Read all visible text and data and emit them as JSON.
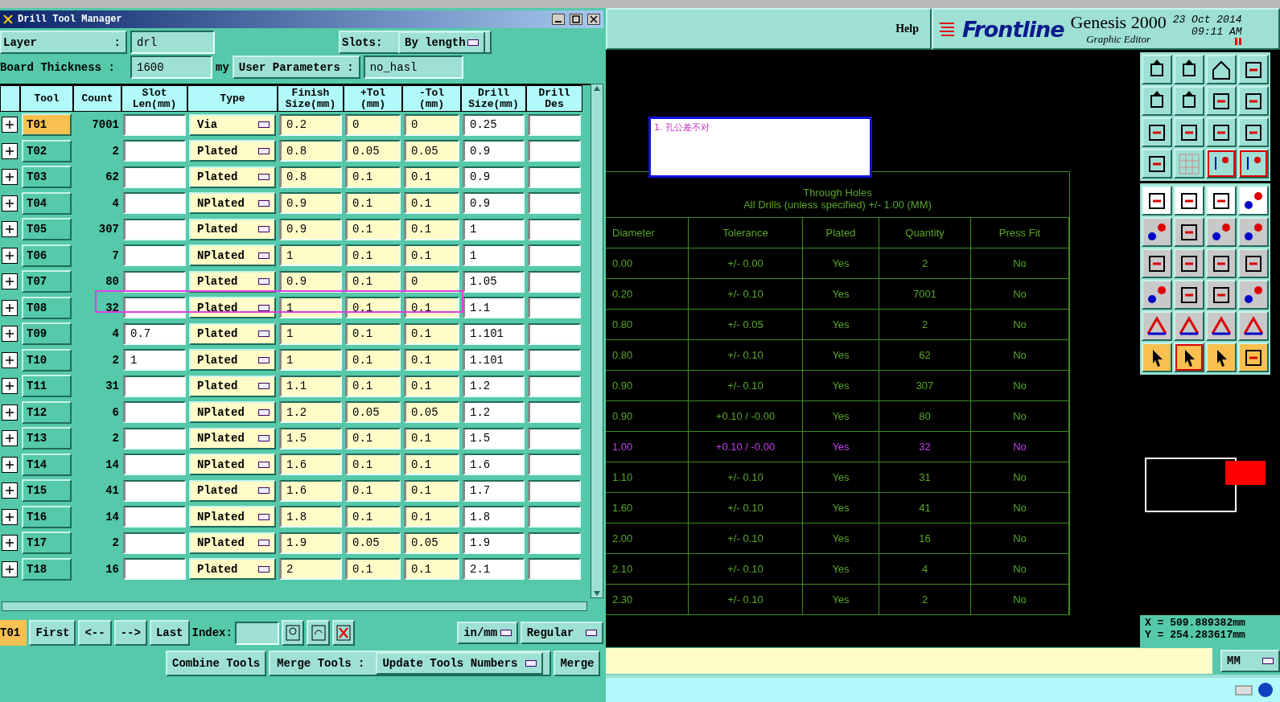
{
  "dialog": {
    "title": "Drill Tool Manager",
    "layer": {
      "label": "Layer",
      "colon": ":",
      "value": "drl"
    },
    "slots": {
      "label": "Slots:",
      "value": "By length"
    },
    "thickness": {
      "label": "Board Thickness :",
      "value": "1600",
      "unit": "my"
    },
    "user_parameters": {
      "label": "User Parameters :",
      "value": "no_hasl"
    },
    "columns": [
      "Tool",
      "Count",
      "Slot Len(mm)",
      "Type",
      "Finish Size(mm)",
      "+Tol (mm)",
      "-Tol (mm)",
      "Drill Size(mm)",
      "Drill Des"
    ],
    "rows": [
      {
        "tool": "T01",
        "count": "7001",
        "slot": "",
        "type": "Via",
        "finish": "0.2",
        "plus_tol": "0",
        "minus_tol": "0",
        "drill": "0.25",
        "selected": true,
        "flagged": false
      },
      {
        "tool": "T02",
        "count": "2",
        "slot": "",
        "type": "Plated",
        "finish": "0.8",
        "plus_tol": "0.05",
        "minus_tol": "0.05",
        "drill": "0.9",
        "selected": false,
        "flagged": false
      },
      {
        "tool": "T03",
        "count": "62",
        "slot": "",
        "type": "Plated",
        "finish": "0.8",
        "plus_tol": "0.1",
        "minus_tol": "0.1",
        "drill": "0.9",
        "selected": false,
        "flagged": false
      },
      {
        "tool": "T04",
        "count": "4",
        "slot": "",
        "type": "NPlated",
        "finish": "0.9",
        "plus_tol": "0.1",
        "minus_tol": "0.1",
        "drill": "0.9",
        "selected": false,
        "flagged": false
      },
      {
        "tool": "T05",
        "count": "307",
        "slot": "",
        "type": "Plated",
        "finish": "0.9",
        "plus_tol": "0.1",
        "minus_tol": "0.1",
        "drill": "1",
        "selected": false,
        "flagged": false
      },
      {
        "tool": "T06",
        "count": "7",
        "slot": "",
        "type": "NPlated",
        "finish": "1",
        "plus_tol": "0.1",
        "minus_tol": "0.1",
        "drill": "1",
        "selected": false,
        "flagged": false
      },
      {
        "tool": "T07",
        "count": "80",
        "slot": "",
        "type": "Plated",
        "finish": "0.9",
        "plus_tol": "0.1",
        "minus_tol": "0",
        "drill": "1.05",
        "selected": false,
        "flagged": false
      },
      {
        "tool": "T08",
        "count": "32",
        "slot": "",
        "type": "Plated",
        "finish": "1",
        "plus_tol": "0.1",
        "minus_tol": "0.1",
        "drill": "1.1",
        "selected": false,
        "flagged": true
      },
      {
        "tool": "T09",
        "count": "4",
        "slot": "0.7",
        "type": "Plated",
        "finish": "1",
        "plus_tol": "0.1",
        "minus_tol": "0.1",
        "drill": "1.101",
        "selected": false,
        "flagged": false
      },
      {
        "tool": "T10",
        "count": "2",
        "slot": "1",
        "type": "Plated",
        "finish": "1",
        "plus_tol": "0.1",
        "minus_tol": "0.1",
        "drill": "1.101",
        "selected": false,
        "flagged": false
      },
      {
        "tool": "T11",
        "count": "31",
        "slot": "",
        "type": "Plated",
        "finish": "1.1",
        "plus_tol": "0.1",
        "minus_tol": "0.1",
        "drill": "1.2",
        "selected": false,
        "flagged": false
      },
      {
        "tool": "T12",
        "count": "6",
        "slot": "",
        "type": "NPlated",
        "finish": "1.2",
        "plus_tol": "0.05",
        "minus_tol": "0.05",
        "drill": "1.2",
        "selected": false,
        "flagged": false
      },
      {
        "tool": "T13",
        "count": "2",
        "slot": "",
        "type": "NPlated",
        "finish": "1.5",
        "plus_tol": "0.1",
        "minus_tol": "0.1",
        "drill": "1.5",
        "selected": false,
        "flagged": false
      },
      {
        "tool": "T14",
        "count": "14",
        "slot": "",
        "type": "NPlated",
        "finish": "1.6",
        "plus_tol": "0.1",
        "minus_tol": "0.1",
        "drill": "1.6",
        "selected": false,
        "flagged": false
      },
      {
        "tool": "T15",
        "count": "41",
        "slot": "",
        "type": "Plated",
        "finish": "1.6",
        "plus_tol": "0.1",
        "minus_tol": "0.1",
        "drill": "1.7",
        "selected": false,
        "flagged": false
      },
      {
        "tool": "T16",
        "count": "14",
        "slot": "",
        "type": "NPlated",
        "finish": "1.8",
        "plus_tol": "0.1",
        "minus_tol": "0.1",
        "drill": "1.8",
        "selected": false,
        "flagged": false
      },
      {
        "tool": "T17",
        "count": "2",
        "slot": "",
        "type": "NPlated",
        "finish": "1.9",
        "plus_tol": "0.05",
        "minus_tol": "0.05",
        "drill": "1.9",
        "selected": false,
        "flagged": false
      },
      {
        "tool": "T18",
        "count": "16",
        "slot": "",
        "type": "Plated",
        "finish": "2",
        "plus_tol": "0.1",
        "minus_tol": "0.1",
        "drill": "2.1",
        "selected": false,
        "flagged": false
      }
    ],
    "nav": {
      "current": "T01",
      "buttons": [
        "First",
        "<--",
        "-->",
        "Last"
      ],
      "index_label": "Index:",
      "units": "in/mm",
      "mode": "Regular"
    },
    "merge": {
      "combine": "Combine Tools",
      "label": "Merge Tools :",
      "option": "Update Tools Numbers",
      "merge": "Merge"
    }
  },
  "editor": {
    "help": "Help",
    "logo": "Frontline",
    "product": "Genesis 2000",
    "subtitle": "Graphic Editor",
    "date": "23 Oct 2014",
    "time": "09:11 AM",
    "note": "1. 孔公差不对",
    "table": {
      "title": "Through Holes",
      "subtitle": "All Drills (unless specified) +/- 1.00 (MM)",
      "columns": [
        "Diameter",
        "Tolerance",
        "Plated",
        "Quantity",
        "Press Fit"
      ],
      "rows": [
        {
          "cells": [
            "0.00",
            "+/- 0.00",
            "Yes",
            "2",
            "No"
          ],
          "flagged": false
        },
        {
          "cells": [
            "0.20",
            "+/- 0.10",
            "Yes",
            "7001",
            "No"
          ],
          "flagged": false
        },
        {
          "cells": [
            "0.80",
            "+/- 0.05",
            "Yes",
            "2",
            "No"
          ],
          "flagged": false
        },
        {
          "cells": [
            "0.80",
            "+/- 0.10",
            "Yes",
            "62",
            "No"
          ],
          "flagged": false
        },
        {
          "cells": [
            "0.90",
            "+/- 0.10",
            "Yes",
            "307",
            "No"
          ],
          "flagged": false
        },
        {
          "cells": [
            "0.90",
            "+0.10 / -0.00",
            "Yes",
            "80",
            "No"
          ],
          "flagged": false
        },
        {
          "cells": [
            "1.00",
            "+0.10 / -0.00",
            "Yes",
            "32",
            "No"
          ],
          "flagged": true
        },
        {
          "cells": [
            "1.10",
            "+/- 0.10",
            "Yes",
            "31",
            "No"
          ],
          "flagged": false
        },
        {
          "cells": [
            "1.60",
            "+/- 0.10",
            "Yes",
            "41",
            "No"
          ],
          "flagged": false
        },
        {
          "cells": [
            "2.00",
            "+/- 0.10",
            "Yes",
            "16",
            "No"
          ],
          "flagged": false
        },
        {
          "cells": [
            "2.10",
            "+/- 0.10",
            "Yes",
            "4",
            "No"
          ],
          "flagged": false
        },
        {
          "cells": [
            "2.30",
            "+/- 0.10",
            "Yes",
            "2",
            "No"
          ],
          "flagged": false
        }
      ]
    },
    "coords": {
      "x": "X = 509.889382mm",
      "y": "Y = 254.283617mm"
    },
    "units": "MM"
  }
}
